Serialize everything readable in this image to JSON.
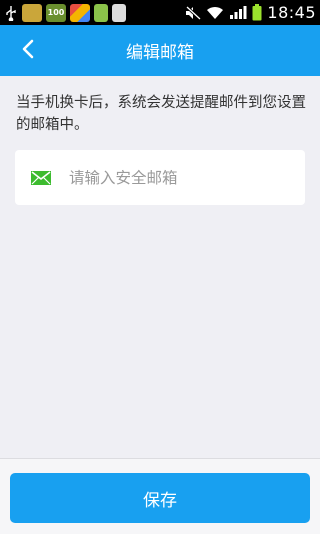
{
  "status_bar": {
    "time": "18:45",
    "icons": [
      "usb-icon",
      "notification-app-icon",
      "notification-100-icon",
      "notification-app-icon",
      "android-icon",
      "sd-card-icon",
      "mute-icon",
      "wifi-icon",
      "signal-icon",
      "battery-icon"
    ],
    "notification_badge": "100"
  },
  "header": {
    "title": "编辑邮箱",
    "back_icon": "chevron-left-icon",
    "color": "#18a0f0"
  },
  "main": {
    "hint": "当手机换卡后，系统会发送提醒邮件到您设置的邮箱中。",
    "email_input": {
      "value": "",
      "placeholder": "请输入安全邮箱",
      "icon": "mail-icon",
      "icon_color": "#3dbb2f"
    }
  },
  "footer": {
    "save_label": "保存"
  }
}
